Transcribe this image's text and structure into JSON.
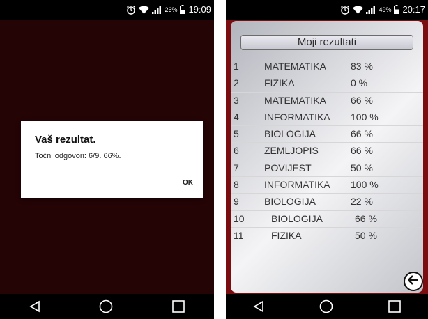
{
  "left_screen": {
    "status": {
      "clock": "19:09",
      "battery": "26%"
    },
    "dialog": {
      "title": "Vaš rezultat.",
      "body": "Točni odgovori: 6/9. 66%.",
      "ok_label": "OK"
    }
  },
  "right_screen": {
    "status": {
      "clock": "20:17",
      "battery": "49%"
    },
    "title": "Moji rezultati",
    "results": [
      {
        "num": "1",
        "subject": "MATEMATIKA",
        "percent": "83 %"
      },
      {
        "num": "2",
        "subject": "FIZIKA",
        "percent": "0 %"
      },
      {
        "num": "3",
        "subject": "MATEMATIKA",
        "percent": "66 %"
      },
      {
        "num": "4",
        "subject": "INFORMATIKA",
        "percent": "100 %"
      },
      {
        "num": "5",
        "subject": "BIOLOGIJA",
        "percent": "66 %"
      },
      {
        "num": "6",
        "subject": "ZEMLJOPIS",
        "percent": "66 %"
      },
      {
        "num": "7",
        "subject": "POVIJEST",
        "percent": "50 %"
      },
      {
        "num": "8",
        "subject": "INFORMATIKA",
        "percent": "100 %"
      },
      {
        "num": "9",
        "subject": "BIOLOGIJA",
        "percent": "22 %"
      },
      {
        "num": "10",
        "subject": "BIOLOGIJA",
        "percent": "66 %"
      },
      {
        "num": "11",
        "subject": "FIZIKA",
        "percent": "50 %"
      }
    ]
  },
  "icons": {
    "status": [
      "alarm-icon",
      "wifi-icon",
      "signal-icon",
      "battery-icon"
    ],
    "nav": [
      "back-nav-icon",
      "home-nav-icon",
      "recents-nav-icon"
    ],
    "app": [
      "arrow-left-circle-icon"
    ]
  },
  "colors": {
    "left_background": "#250406",
    "right_frame": "#7a0d10",
    "panel": "#eeeef0"
  }
}
